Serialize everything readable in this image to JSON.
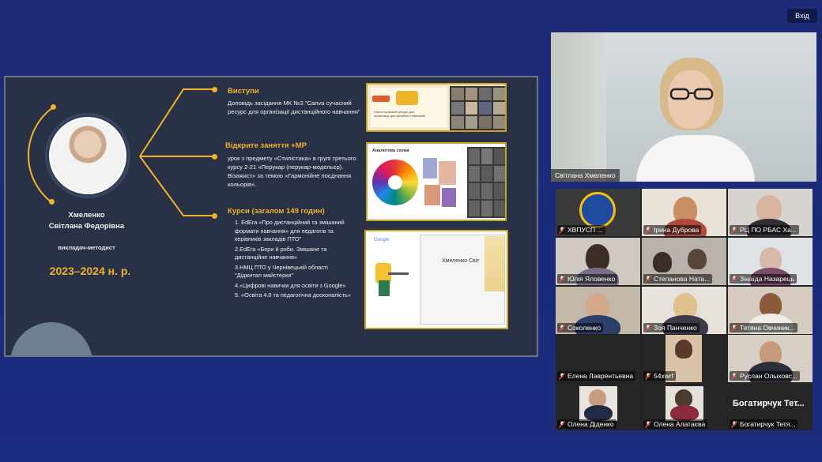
{
  "topbar": {
    "login_label": "Вхід"
  },
  "slide": {
    "person_name_line1": "Хмеленко",
    "person_name_line2": "Світлана Федорівна",
    "person_role": "викладач-методист",
    "year": "2023–2024 н. р.",
    "sections": [
      {
        "title": "Виступи",
        "text": "Доповідь засідання МК №3 \"Canva сучасний ресурс для організації дистанційного навчання\""
      },
      {
        "title": "Відкрите заняття +МР",
        "text": "урок з предмету «Стилістика» в групі третього курсу 2-21 «Перукар (перукар-модельєр). Візажист» за темою «Гармонійне поєднання кольорів»."
      },
      {
        "title": "Курси (загалом 149 годин)",
        "items": [
          "1. EdEra «Про дистанційний та змішаний формати навчання» для педагогів та керівників закладів ПТО\"",
          "2.EdEra «Бери й роби. Змішане та дистанційне навчання»",
          "3.НМЦ ПТО у Чернівецькій області \"Діджитал майстерки\"",
          "4.«Цифрові навички для освіти з Google»",
          "5. «Освіта 4.0 та педагогічна досконалість»"
        ]
      }
    ],
    "thumb_texts": {
      "canva": "Canva сучасний ресурс для організації дистанційного навчання",
      "colour": "Аналогова схема",
      "google": "Google",
      "certificate_name": "Хмеленко Світ"
    }
  },
  "speaker": {
    "name": "Світлана Хмеленко"
  },
  "participants": [
    {
      "name": "ХВПУСП ..."
    },
    {
      "name": "Ірина Дуброва"
    },
    {
      "name": "РЦ ПО РБАС Ха..."
    },
    {
      "name": "Юлія Яловенко"
    },
    {
      "name": "Степанова Ната..."
    },
    {
      "name": "Зінаїда Назарець"
    },
    {
      "name": "Соколенко"
    },
    {
      "name": "Зоя Панченко"
    },
    {
      "name": "Тетяна Овчиник..."
    },
    {
      "name": "Елена Лаврентьевна"
    },
    {
      "name": "54xwrf"
    },
    {
      "name": "Руслан Олыховс..."
    },
    {
      "name": "Олена Діденко"
    },
    {
      "name": "Олена Алатаєва"
    },
    {
      "name": "Богатирчук Тетя...",
      "display_big": "Богатирчук Тет..."
    }
  ],
  "colors": {
    "accent": "#f0b429",
    "slide_bg": "#283145",
    "muted_mic": "#e74c3c"
  }
}
